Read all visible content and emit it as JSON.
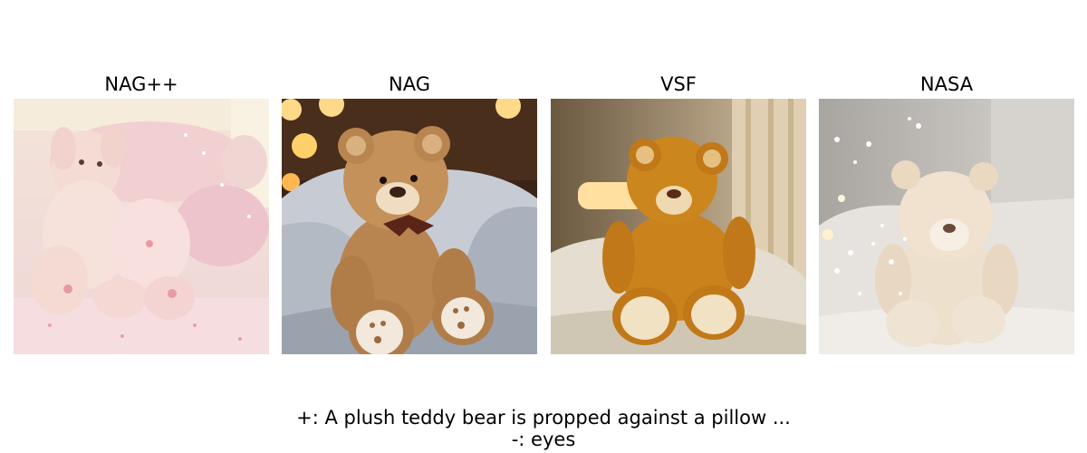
{
  "panels": [
    {
      "title": "NAG++",
      "image": "pink plush bunny toys among pillows on a pastel bed"
    },
    {
      "title": "NAG",
      "image": "fluffy brown teddy bear with a bow sitting on gray pillows, warm bokeh lights"
    },
    {
      "title": "VSF",
      "image": "smooth orange teddy bear propped on a white pillow by a lamp"
    },
    {
      "title": "NASA",
      "image": "soft cream teddy bear on a white bed with sparkle lights"
    }
  ],
  "caption": {
    "positive": "+: A plush teddy bear is propped against a pillow ...",
    "negative": "-: eyes"
  }
}
